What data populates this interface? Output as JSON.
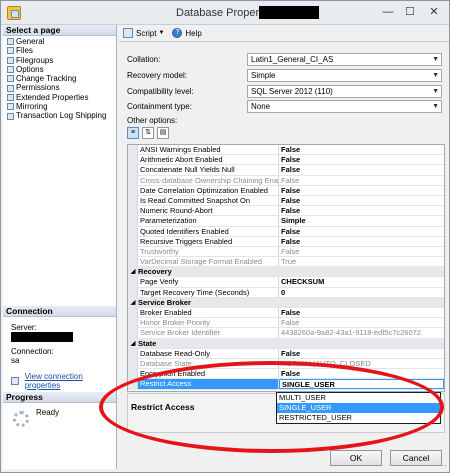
{
  "window": {
    "title": "Database Properties"
  },
  "left_pane": {
    "select_page_header": "Select a page",
    "pages": [
      {
        "label": "General"
      },
      {
        "label": "Files"
      },
      {
        "label": "Filegroups"
      },
      {
        "label": "Options"
      },
      {
        "label": "Change Tracking"
      },
      {
        "label": "Permissions"
      },
      {
        "label": "Extended Properties"
      },
      {
        "label": "Mirroring"
      },
      {
        "label": "Transaction Log Shipping"
      }
    ],
    "connection_header": "Connection",
    "server_label": "Server:",
    "connection_label": "Connection:",
    "connection_value": "sa",
    "view_connection_link": "View connection properties",
    "progress_header": "Progress",
    "progress_status": "Ready"
  },
  "toolbar": {
    "script_label": "Script",
    "help_label": "Help"
  },
  "form": {
    "collation_label": "Collation:",
    "collation_value": "Latin1_General_CI_AS",
    "recovery_model_label": "Recovery model:",
    "recovery_model_value": "Simple",
    "compat_label": "Compatibility level:",
    "compat_value": "SQL Server 2012 (110)",
    "containment_label": "Containment type:",
    "containment_value": "None",
    "other_options_label": "Other options:"
  },
  "grid": {
    "rows": [
      {
        "name": "ANSI Warnings Enabled",
        "value": "False"
      },
      {
        "name": "Arithmetic Abort Enabled",
        "value": "False"
      },
      {
        "name": "Concatenate Null Yields Null",
        "value": "False"
      },
      {
        "name": "Cross-database Ownership Chaining Enabled",
        "value": "False"
      },
      {
        "name": "Date Correlation Optimization Enabled",
        "value": "False"
      },
      {
        "name": "Is Read Committed Snapshot On",
        "value": "False"
      },
      {
        "name": "Numeric Round-Abort",
        "value": "False"
      },
      {
        "name": "Parameterization",
        "value": "Simple"
      },
      {
        "name": "Quoted Identifiers Enabled",
        "value": "False"
      },
      {
        "name": "Recursive Triggers Enabled",
        "value": "False"
      },
      {
        "name": "Trustworthy",
        "value": "False"
      },
      {
        "name": "VarDecimal Storage Format Enabled",
        "value": "True"
      },
      {
        "category": "Recovery"
      },
      {
        "name": "Page Verify",
        "value": "CHECKSUM"
      },
      {
        "name": "Target Recovery Time (Seconds)",
        "value": "0"
      },
      {
        "category": "Service Broker"
      },
      {
        "name": "Broker Enabled",
        "value": "False"
      },
      {
        "name": "Honor Broker Priority",
        "value": "False"
      },
      {
        "name": "Service Broker Identifier",
        "value": "4438260a-9a82-43a1-9118-edf5c7c26072"
      },
      {
        "category": "State"
      },
      {
        "name": "Database Read-Only",
        "value": "False"
      },
      {
        "name": "Database State",
        "value": "NORMAL|AUTO_CLOSED"
      },
      {
        "name": "Encryption Enabled",
        "value": "False"
      },
      {
        "name": "Restrict Access",
        "value": "SINGLE_USER"
      }
    ]
  },
  "dropdown": {
    "options": [
      {
        "label": "MULTI_USER"
      },
      {
        "label": "SINGLE_USER"
      },
      {
        "label": "RESTRICTED_USER"
      }
    ]
  },
  "description": {
    "title": "Restrict Access"
  },
  "buttons": {
    "ok_label": "OK",
    "cancel_label": "Cancel"
  },
  "colors": {
    "selection": "#3399ff",
    "annotation": "#e5141a"
  }
}
